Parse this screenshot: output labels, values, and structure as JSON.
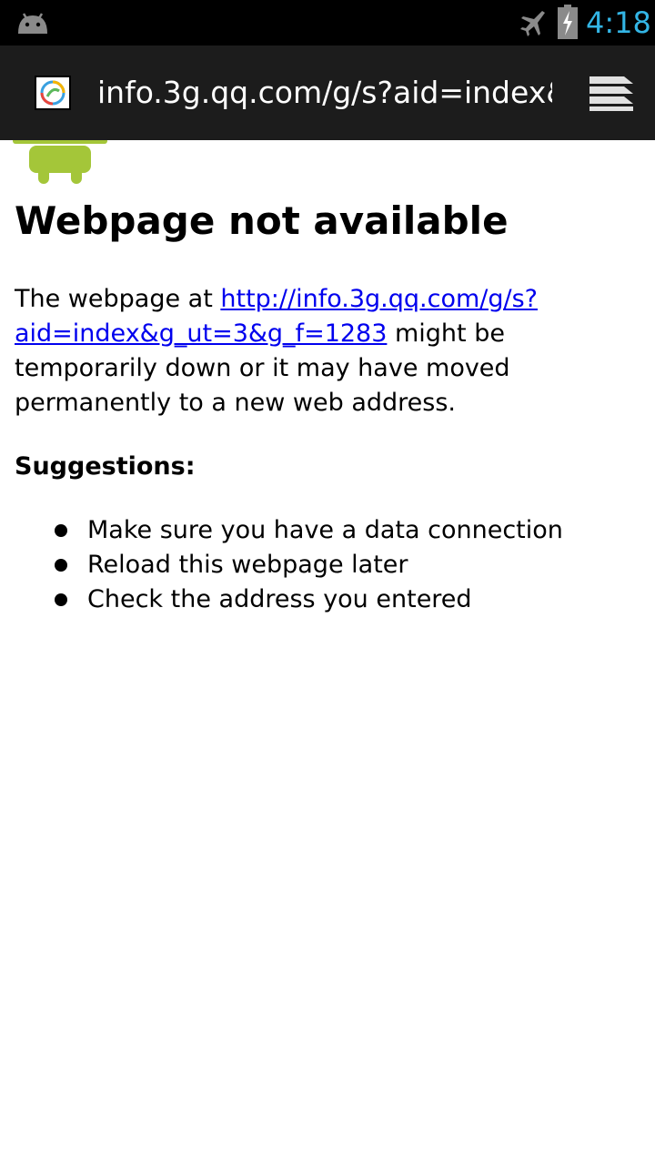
{
  "status_bar": {
    "time": "4:18",
    "accent_color": "#33b5e5",
    "icons": [
      "android-icon",
      "airplane-mode-icon",
      "battery-charging-icon"
    ]
  },
  "url_bar": {
    "url": "info.3g.qq.com/g/s?aid=index&",
    "favicon": "favicon-icon",
    "tabs_icon": "tabs-icon"
  },
  "page": {
    "title": "Webpage not available",
    "description_prefix": "The webpage at ",
    "link_text": "http://info.3g.qq.com/g/s?aid=index&g_ut=3&g_f=1283",
    "description_suffix": " might be temporarily down or it may have moved permanently to a new web address.",
    "link_color": "#0000ee",
    "suggestions_heading": "Suggestions:",
    "suggestions": [
      "Make sure you have a data connection",
      "Reload this webpage later",
      "Check the address you entered"
    ]
  }
}
